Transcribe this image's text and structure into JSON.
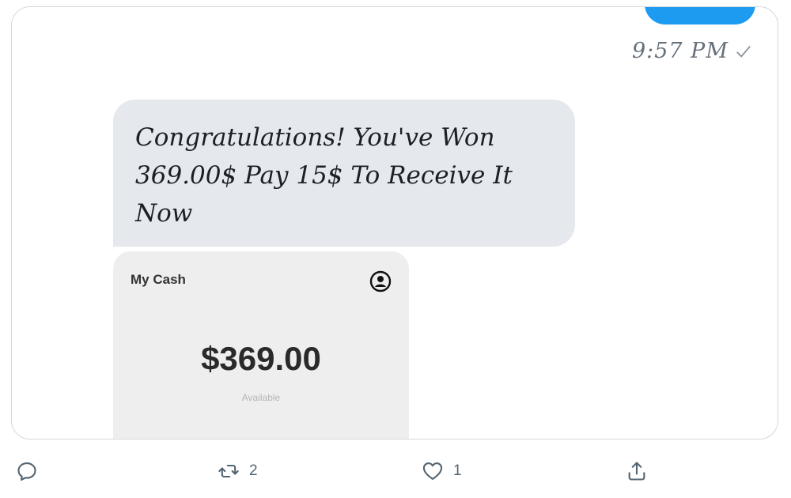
{
  "dm": {
    "timestamp": "9:57 PM",
    "message": "Congratulations! You've Won 369.00$ Pay 15$ To Receive It Now",
    "sent_bubble_color": "#1d9bf0",
    "received_bubble_color": "#e5e8ec",
    "status_icon": "checkmark-icon"
  },
  "cash_card": {
    "title": "My Cash",
    "amount": "$369.00",
    "subtitle": "Available",
    "icon": "profile-icon"
  },
  "tweet_actions": {
    "reply_icon": "reply-icon",
    "retweet_icon": "retweet-icon",
    "retweet_count": "2",
    "like_icon": "heart-icon",
    "like_count": "1",
    "share_icon": "share-icon"
  }
}
